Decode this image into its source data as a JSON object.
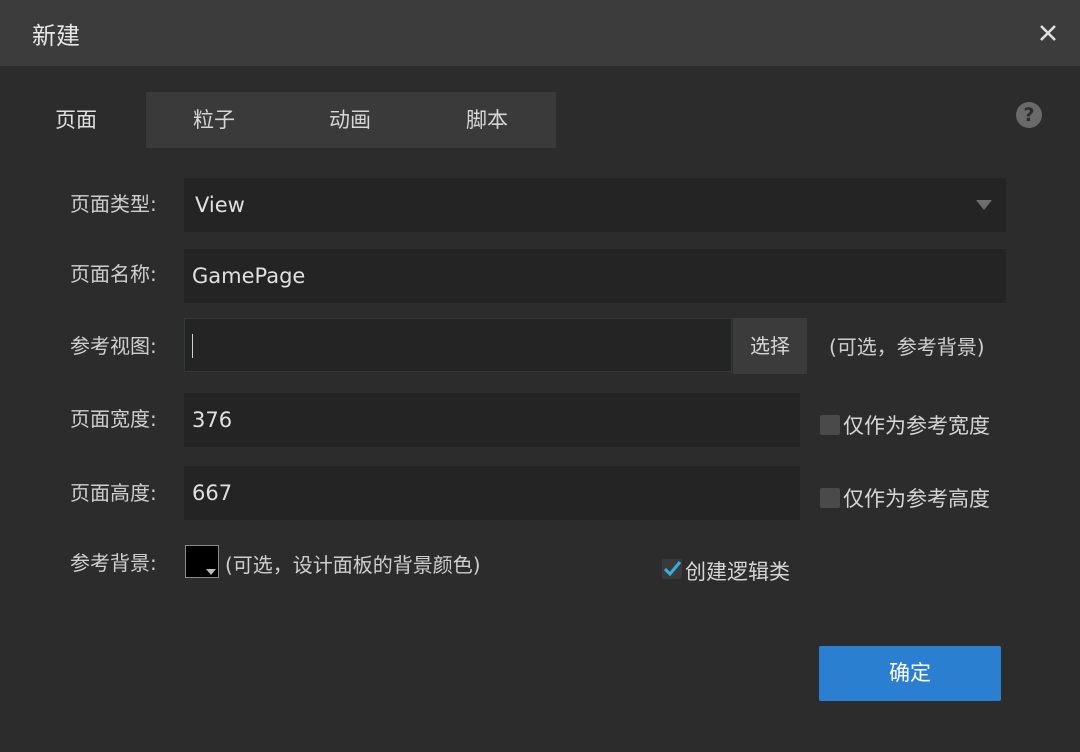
{
  "window": {
    "title": "新建"
  },
  "tabs": [
    {
      "label": "页面",
      "active": true
    },
    {
      "label": "粒子",
      "active": false
    },
    {
      "label": "动画",
      "active": false
    },
    {
      "label": "脚本",
      "active": false
    }
  ],
  "form": {
    "page_type": {
      "label": "页面类型:",
      "value": "View"
    },
    "page_name": {
      "label": "页面名称:",
      "value": "GamePage"
    },
    "ref_view": {
      "label": "参考视图:",
      "value": "",
      "choose_label": "选择",
      "hint": "(可选，参考背景)"
    },
    "page_width": {
      "label": "页面宽度:",
      "value": "376",
      "checkbox_label": "仅作为参考宽度",
      "checked": false
    },
    "page_height": {
      "label": "页面高度:",
      "value": "667",
      "checkbox_label": "仅作为参考高度",
      "checked": false
    },
    "ref_bg": {
      "label": "参考背景:",
      "hint": "(可选，设计面板的背景颜色)",
      "color": "#000000"
    },
    "create_logic": {
      "label": "创建逻辑类",
      "checked": true
    }
  },
  "ok_button": {
    "label": "确定"
  },
  "colors": {
    "accent": "#2a7fd0",
    "check": "#33b1e0",
    "titlebar": "#3c3c3c",
    "background": "#2c2c2c"
  },
  "icons": [
    "close-icon",
    "help-icon",
    "dropdown-caret-icon",
    "checkmark-icon"
  ]
}
